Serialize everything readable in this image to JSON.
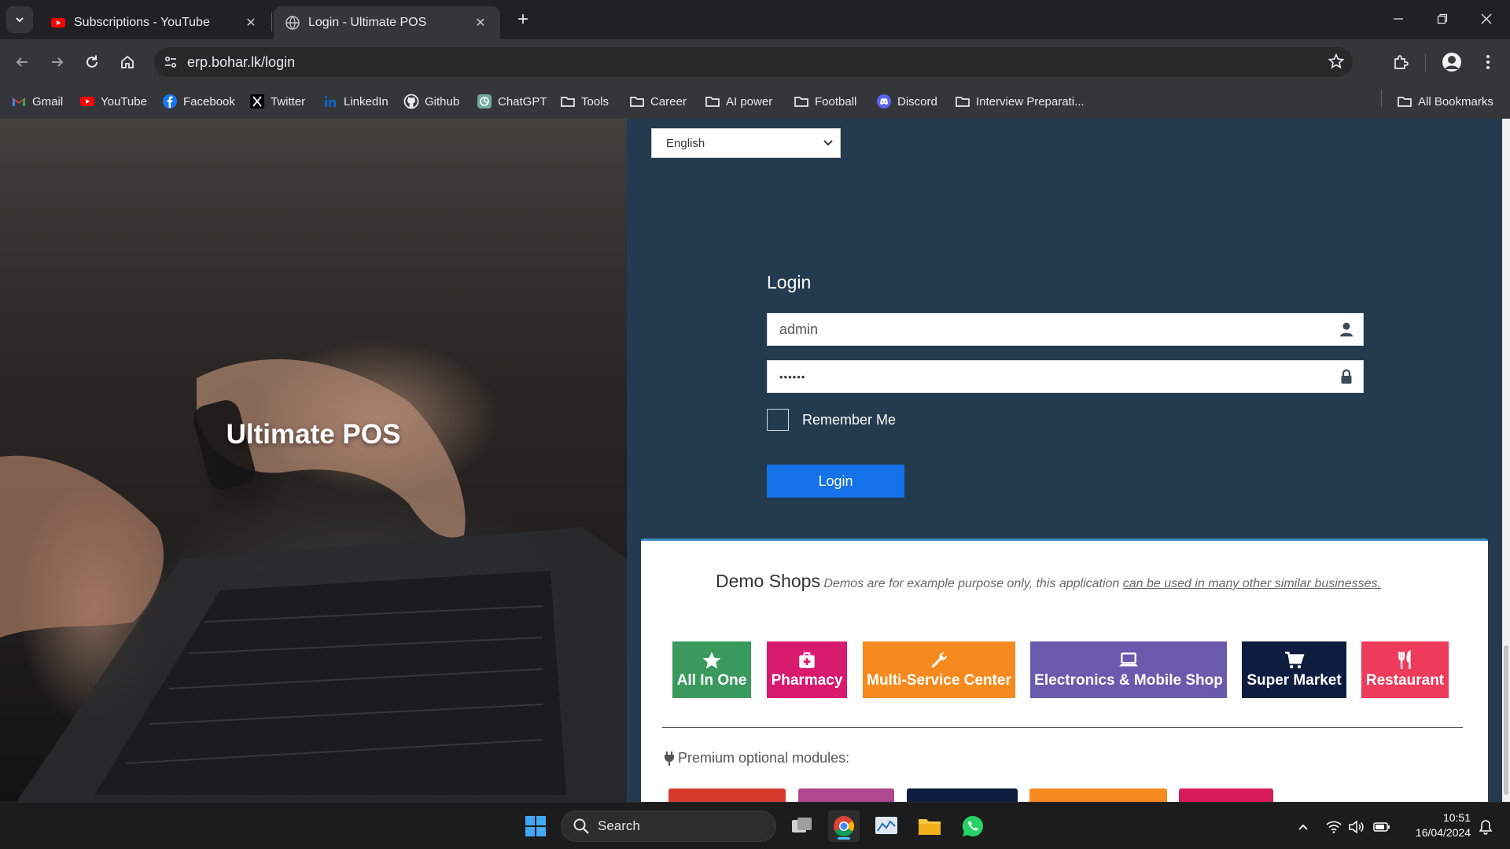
{
  "browser": {
    "tabs": [
      {
        "title": "Subscriptions - YouTube",
        "favicon": "youtube-icon"
      },
      {
        "title": "Login - Ultimate POS",
        "favicon": "globe-icon"
      }
    ],
    "url": "erp.bohar.lk/login",
    "bookmarks": [
      {
        "label": "Gmail",
        "icon": "gmail-icon"
      },
      {
        "label": "YouTube",
        "icon": "youtube-icon"
      },
      {
        "label": "Facebook",
        "icon": "facebook-icon"
      },
      {
        "label": "Twitter",
        "icon": "x-icon"
      },
      {
        "label": "LinkedIn",
        "icon": "linkedin-icon"
      },
      {
        "label": "Github",
        "icon": "github-icon"
      },
      {
        "label": "ChatGPT",
        "icon": "chatgpt-icon"
      },
      {
        "label": "Tools",
        "icon": "folder-icon"
      },
      {
        "label": "Career",
        "icon": "folder-icon"
      },
      {
        "label": "AI power",
        "icon": "folder-icon"
      },
      {
        "label": "Football",
        "icon": "folder-icon"
      },
      {
        "label": "Discord",
        "icon": "discord-icon"
      },
      {
        "label": "Interview Preparati...",
        "icon": "folder-icon"
      }
    ],
    "all_bookmarks": "All Bookmarks"
  },
  "hero": {
    "title": "Ultimate POS"
  },
  "login": {
    "language": "English",
    "title": "Login",
    "username": "admin",
    "password_masked": "••••••",
    "remember_label": "Remember Me",
    "button": "Login"
  },
  "demo": {
    "heading": "Demo Shops",
    "note_prefix": "Demos are for example purpose only, this application ",
    "note_link": "can be used in many other similar businesses.",
    "shops": [
      {
        "label": "All In One",
        "icon": "star-icon",
        "color": "#3a9a5e"
      },
      {
        "label": "Pharmacy",
        "icon": "medkit-icon",
        "color": "#d81b6e"
      },
      {
        "label": "Multi-Service Center",
        "icon": "wrench-icon",
        "color": "#f68a1f"
      },
      {
        "label": "Electronics & Mobile Shop",
        "icon": "laptop-icon",
        "color": "#6a5aad"
      },
      {
        "label": "Super Market",
        "icon": "cart-icon",
        "color": "#0e1d3f"
      },
      {
        "label": "Restaurant",
        "icon": "cutlery-icon",
        "color": "#ee3b5b"
      }
    ],
    "premium_label": "Premium optional modules:",
    "module_colors": [
      "#d73a2c",
      "#b0478f",
      "#0e1d3f",
      "#f68a1f",
      "#d81b5a"
    ]
  },
  "taskbar": {
    "search_label": "Search",
    "time": "10:51",
    "date": "16/04/2024"
  }
}
